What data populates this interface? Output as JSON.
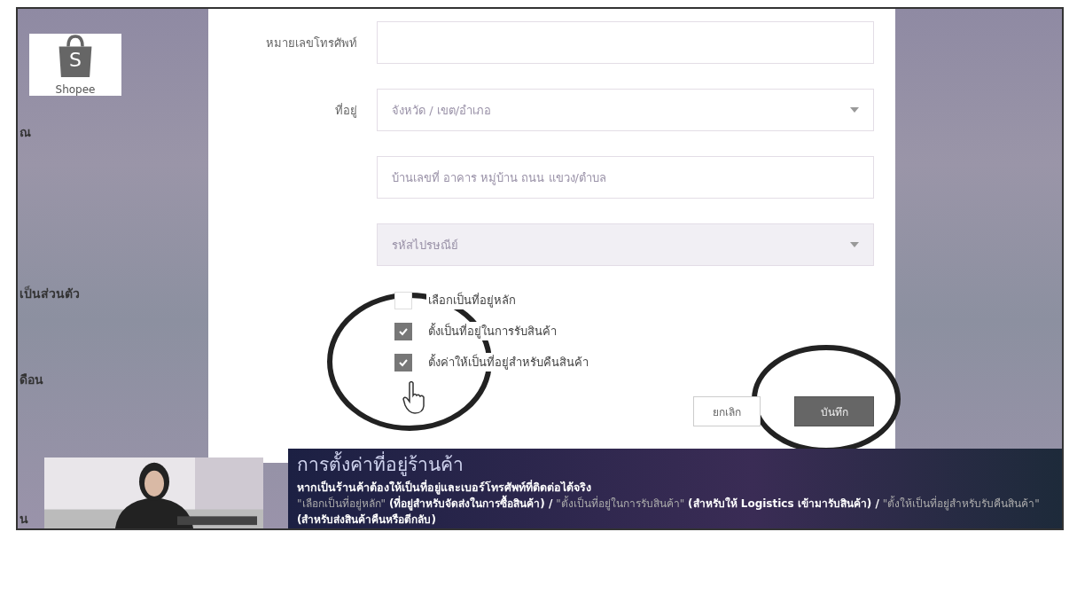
{
  "background_page": {
    "sidebar_fragments": [
      "ณ",
      "เป็นส่วนตัว",
      "ดือน",
      "น"
    ]
  },
  "logo": {
    "mark": "S",
    "text": "Shopee"
  },
  "form": {
    "fields": [
      {
        "kind": "input",
        "label": "หมายเลขโทรศัพท์",
        "disabled": false
      },
      {
        "kind": "select",
        "label": "ที่อยู่",
        "placeholder": "จังหวัด / เขต/อำเภอ",
        "disabled": false
      },
      {
        "kind": "input",
        "placeholder": "บ้านเลขที่ อาคาร หมู่บ้าน ถนน แขวง/ตำบล",
        "disabled": false
      },
      {
        "kind": "select",
        "placeholder": "รหัสไปรษณีย์",
        "disabled": true
      }
    ],
    "checkboxes": [
      {
        "label": "เลือกเป็นที่อยู่หลัก",
        "checked": false
      },
      {
        "label": "ตั้งเป็นที่อยู่ในการรับสินค้า",
        "checked": true
      },
      {
        "label": "ตั้งค่าให้เป็นที่อยู่สำหรับคืนสินค้า",
        "checked": true
      }
    ],
    "buttons": [
      {
        "label": "ยกเลิก",
        "kind": "secondary"
      },
      {
        "label": "บันทึก",
        "kind": "primary"
      }
    ]
  },
  "video_caption": {
    "title": "การตั้งค่าที่อยู่ร้านค้า",
    "subtitle": "หากเป็นร้านค้าต้องให้เป็นที่อยู่และเบอร์โทรศัพท์ที่ติดต่อได้จริง",
    "segments": [
      {
        "kind": "quote",
        "text": "\"เลือกเป็นที่อยู่หลัก\""
      },
      {
        "kind": "note",
        "text": "(ที่อยู่สำหรับจัดส่งในการซื้อสินค้า) /"
      },
      {
        "kind": "quote",
        "text": "\"ตั้งเป็นที่อยู่ในการรับสินค้า\""
      },
      {
        "kind": "note",
        "text": "(สำหรับให้ Logistics เข้ามารับสินค้า) /"
      },
      {
        "kind": "quote",
        "text": "\"ตั้งให้เป็นที่อยู่สำหรับรับคืนสินค้า\""
      },
      {
        "kind": "note",
        "text": "(สำหรับส่งสินค้าคืนหรือตีกลับ)"
      }
    ]
  }
}
